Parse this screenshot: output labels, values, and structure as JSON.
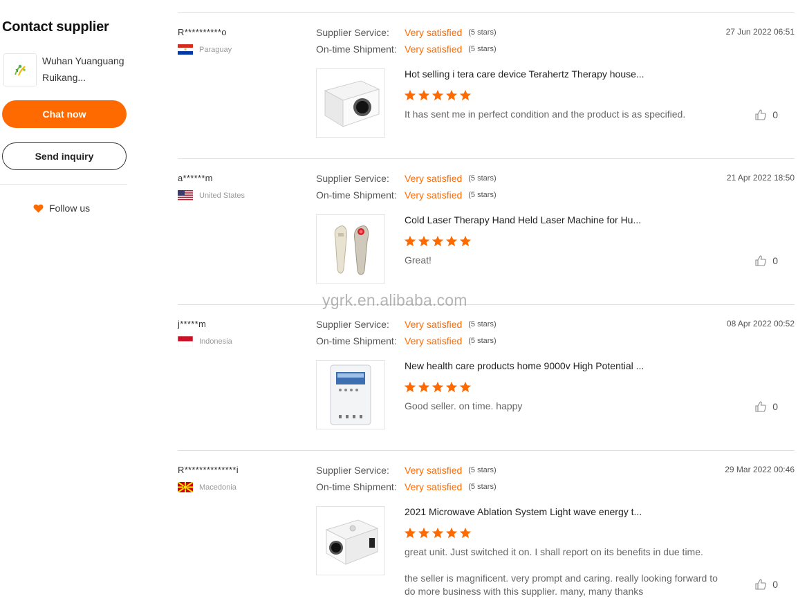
{
  "sidebar": {
    "title": "Contact supplier",
    "supplier_name": "Wuhan Yuanguang Ruikang...",
    "chat_label": "Chat now",
    "inquiry_label": "Send inquiry",
    "follow_label": "Follow us"
  },
  "rating_labels": {
    "service": "Supplier Service:",
    "shipment": "On-time Shipment:"
  },
  "reviews": [
    {
      "user": "R**********o",
      "country": "Paraguay",
      "date": "27 Jun 2022 06:51",
      "service_value": "Very satisfied",
      "service_stars": "(5 stars)",
      "shipment_value": "Very satisfied",
      "shipment_stars": "(5 stars)",
      "product_title": "Hot selling i tera care device Terahertz Therapy house...",
      "stars": 5,
      "comment": "It has sent me in perfect condition and the product is as specified.",
      "likes": "0"
    },
    {
      "user": "a******m",
      "country": "United States",
      "date": "21 Apr 2022 18:50",
      "service_value": "Very satisfied",
      "service_stars": "(5 stars)",
      "shipment_value": "Very satisfied",
      "shipment_stars": "(5 stars)",
      "product_title": "Cold Laser Therapy Hand Held Laser Machine for Hu...",
      "stars": 5,
      "comment": "Great!",
      "likes": "0"
    },
    {
      "user": "j*****m",
      "country": "Indonesia",
      "date": "08 Apr 2022 00:52",
      "service_value": "Very satisfied",
      "service_stars": "(5 stars)",
      "shipment_value": "Very satisfied",
      "shipment_stars": "(5 stars)",
      "product_title": "New health care products home 9000v High Potential ...",
      "stars": 5,
      "comment": "Good seller. on time. happy",
      "likes": "0"
    },
    {
      "user": "R**************i",
      "country": "Macedonia",
      "date": "29 Mar 2022 00:46",
      "service_value": "Very satisfied",
      "service_stars": "(5 stars)",
      "shipment_value": "Very satisfied",
      "shipment_stars": "(5 stars)",
      "product_title": "2021 Microwave Ablation System Light wave energy t...",
      "stars": 5,
      "comment": "great unit. Just switched it on. I shall report on its benefits in due time.\n\nthe seller is magnificent. very prompt and caring. really looking forward to do more business with this supplier. many, many thanks",
      "likes": "0"
    }
  ],
  "watermark": "ygrk.en.alibaba.com",
  "colors": {
    "accent": "#ff6a00",
    "divider": "#e0e0e0"
  }
}
